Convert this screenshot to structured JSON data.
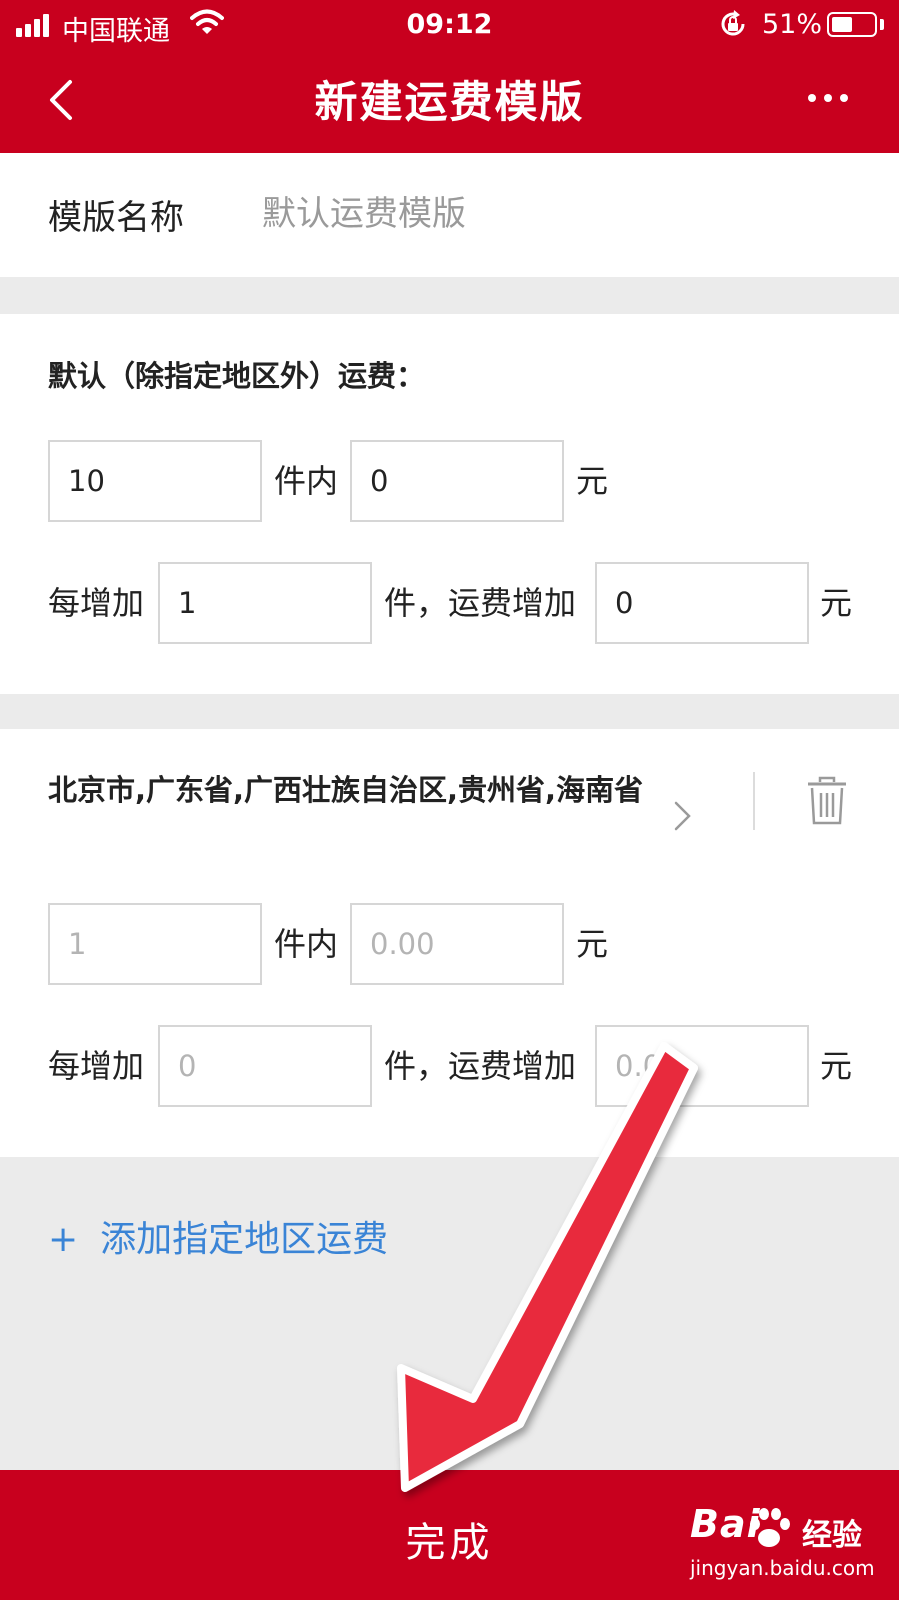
{
  "status_bar": {
    "carrier": "中国联通",
    "time": "09:12",
    "battery": "51%",
    "battery_level": 0.51
  },
  "header": {
    "title": "新建运费模版",
    "back_icon": "chevron-left-icon",
    "more_icon": "more-horizontal-icon",
    "background": "#c8001e"
  },
  "template_name": {
    "label": "模版名称",
    "placeholder": "默认运费模版",
    "value": ""
  },
  "default_rule": {
    "title": "默认（除指定地区外）运费：",
    "first_count": "10",
    "first_unit": "件内",
    "first_fee": "0",
    "currency": "元",
    "each_add_label": "每增加",
    "add_count": "1",
    "add_unit": "件，运费增加",
    "add_fee": "0"
  },
  "area_rule": {
    "regions": "北京市,广东省,广西壮族自治区,贵州省,海南省",
    "first_count_placeholder": "1",
    "first_unit": "件内",
    "first_fee_placeholder": "0.00",
    "currency": "元",
    "each_add_label": "每增加",
    "add_count_placeholder": "0",
    "add_unit": "件，运费增加",
    "add_fee_placeholder": "0.00",
    "chevron_icon": "chevron-right-icon",
    "delete_icon": "trash-icon"
  },
  "add_area": {
    "plus": "+",
    "label": "添加指定地区运费",
    "color": "#3a84d6"
  },
  "footer": {
    "done_label": "完成"
  },
  "watermark": {
    "logo": "Bai",
    "logo_tail": "经验",
    "url": "jingyan.baidu.com"
  },
  "overlay": {
    "arrow_color": "#e8293c"
  }
}
